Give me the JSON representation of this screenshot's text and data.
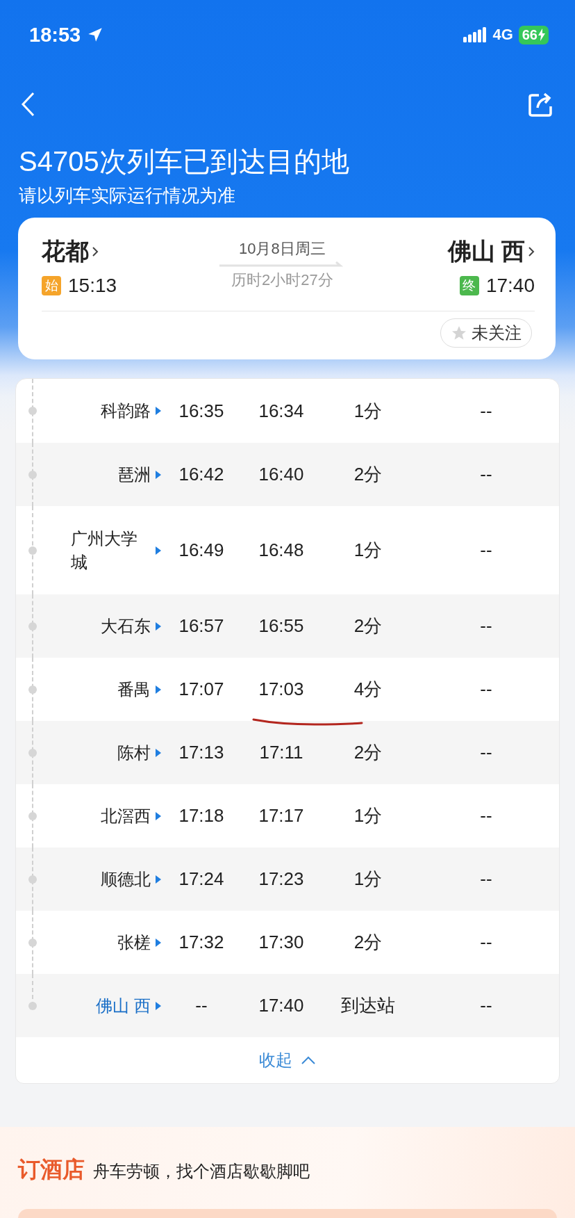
{
  "status_bar": {
    "time": "18:53",
    "network": "4G",
    "battery": "66"
  },
  "header": {
    "title": "S4705次列车已到达目的地",
    "subtitle": "请以列车实际运行情况为准"
  },
  "trip": {
    "from": {
      "station": "花都",
      "badge": "始",
      "time": "15:13"
    },
    "date": "10月8日周三",
    "duration": "历时2小时27分",
    "to": {
      "station": "佛山 西",
      "badge": "终",
      "time": "17:40"
    },
    "follow": {
      "label": "未关注",
      "followed": false
    }
  },
  "stops": [
    {
      "name": "科韵路",
      "column_2": "16:35",
      "column_3": "16:34",
      "column_4": "1分",
      "column_5": "--",
      "kind": "stop"
    },
    {
      "name": "琶洲",
      "column_2": "16:42",
      "column_3": "16:40",
      "column_4": "2分",
      "column_5": "--",
      "kind": "stop"
    },
    {
      "name": "广州大学城",
      "column_2": "16:49",
      "column_3": "16:48",
      "column_4": "1分",
      "column_5": "--",
      "kind": "stop"
    },
    {
      "name": "大石东",
      "column_2": "16:57",
      "column_3": "16:55",
      "column_4": "2分",
      "column_5": "--",
      "kind": "stop"
    },
    {
      "name": "番禺",
      "column_2": "17:07",
      "column_3": "17:03",
      "column_4": "4分",
      "column_5": "--",
      "kind": "stop"
    },
    {
      "name": "陈村",
      "column_2": "17:13",
      "column_3": "17:11",
      "column_4": "2分",
      "column_5": "--",
      "kind": "stop"
    },
    {
      "name": "北滘西",
      "column_2": "17:18",
      "column_3": "17:17",
      "column_4": "1分",
      "column_5": "--",
      "kind": "stop"
    },
    {
      "name": "顺德北",
      "column_2": "17:24",
      "column_3": "17:23",
      "column_4": "1分",
      "column_5": "--",
      "kind": "stop"
    },
    {
      "name": "张槎",
      "column_2": "17:32",
      "column_3": "17:30",
      "column_4": "2分",
      "column_5": "--",
      "kind": "stop"
    },
    {
      "name": "佛山 西",
      "column_2": "--",
      "column_3": "17:40",
      "column_4": "到达站",
      "column_5": "--",
      "kind": "terminal"
    }
  ],
  "collapse": "收起",
  "hotel": {
    "title": "订酒店",
    "tagline": "舟车劳顿，找个酒店歇歇脚吧"
  }
}
